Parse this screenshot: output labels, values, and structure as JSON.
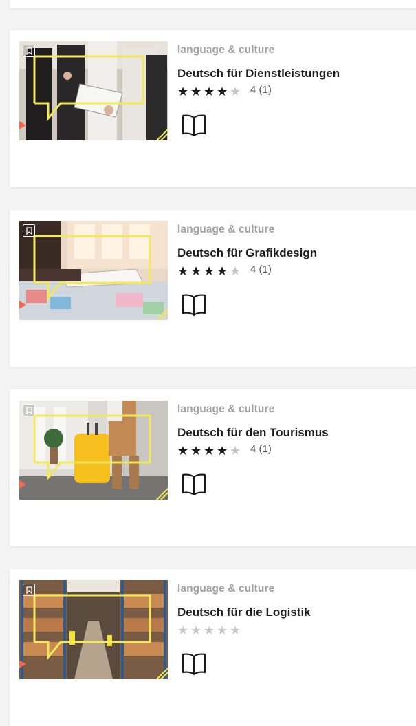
{
  "courses": [
    {
      "category": "language & culture",
      "title": "Deutsch für Dienstleistungen",
      "rating_value": 4,
      "rating_text": "4 (1)",
      "image": "people-with-clipboard-photo",
      "icon": "book-icon"
    },
    {
      "category": "language & culture",
      "title": "Deutsch für Grafikdesign",
      "rating_value": 4,
      "rating_text": "4 (1)",
      "image": "designer-desk-photo",
      "icon": "book-icon"
    },
    {
      "category": "language & culture",
      "title": "Deutsch für den Tourismus",
      "rating_value": 4,
      "rating_text": "4 (1)",
      "image": "traveler-suitcase-photo",
      "icon": "book-icon"
    },
    {
      "category": "language & culture",
      "title": "Deutsch für die Logistik",
      "rating_value": 0,
      "rating_text": "",
      "image": "warehouse-photo",
      "icon": "book-icon"
    }
  ],
  "colors": {
    "accent_yellow": "#f3e85a",
    "accent_coral": "#f26b4f",
    "category_gray": "#a0a0a0",
    "star_filled": "#1a1a1a",
    "star_empty": "#c6c6c6"
  }
}
